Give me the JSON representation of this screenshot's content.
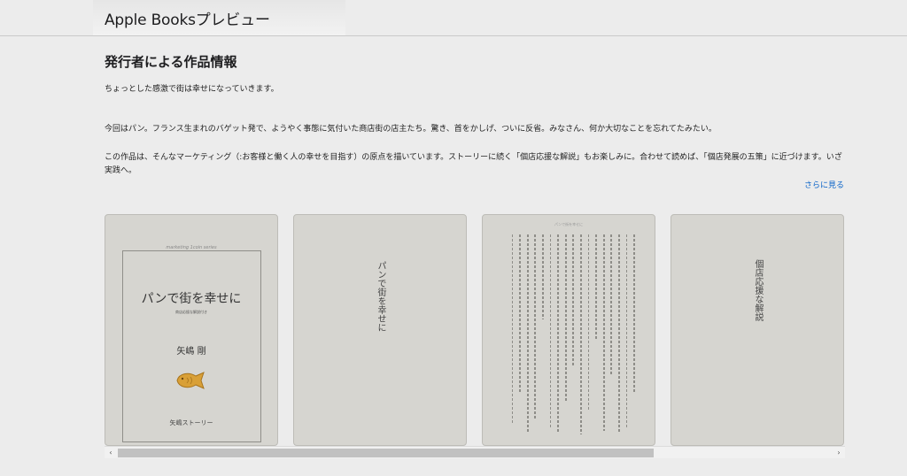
{
  "header": {
    "brand": "Apple Booksプレビュー"
  },
  "section": {
    "title": "発行者による作品情報",
    "paragraphs": [
      "ちょっとした感激で街は幸せになっていきます。",
      "今回はパン。フランス生まれのバゲット発で、ようやく事態に気付いた商店街の店主たち。驚き、首をかしげ、ついに反省。みなさん、何か大切なことを忘れてたみたい。",
      "この作品は、そんなマーケティング（:お客様と働く人の幸せを目指す）の原点を描いています。ストーリーに続く「個店応援な解説」もお楽しみに。合わせて読めば、「個店発展の五策」に近づけます。いざ実践へ。"
    ],
    "more_link": "さらに見る"
  },
  "preview": {
    "cover": {
      "series": "marketing 1coin series",
      "title": "パンで街を幸せに",
      "subtitle": "商店応援な解説付き",
      "author": "矢嶋 剛",
      "publisher": "矢嶋ストーリー",
      "taiyaki_color": "#d9a037"
    },
    "page2_title": "パンで街を幸せに",
    "page3_running_head": "パンで街を幸せに",
    "page4_title": "個店応援な解説"
  },
  "scrollbar": {
    "left_arrow": "‹",
    "right_arrow": "›",
    "thumb_fraction": 0.75
  }
}
